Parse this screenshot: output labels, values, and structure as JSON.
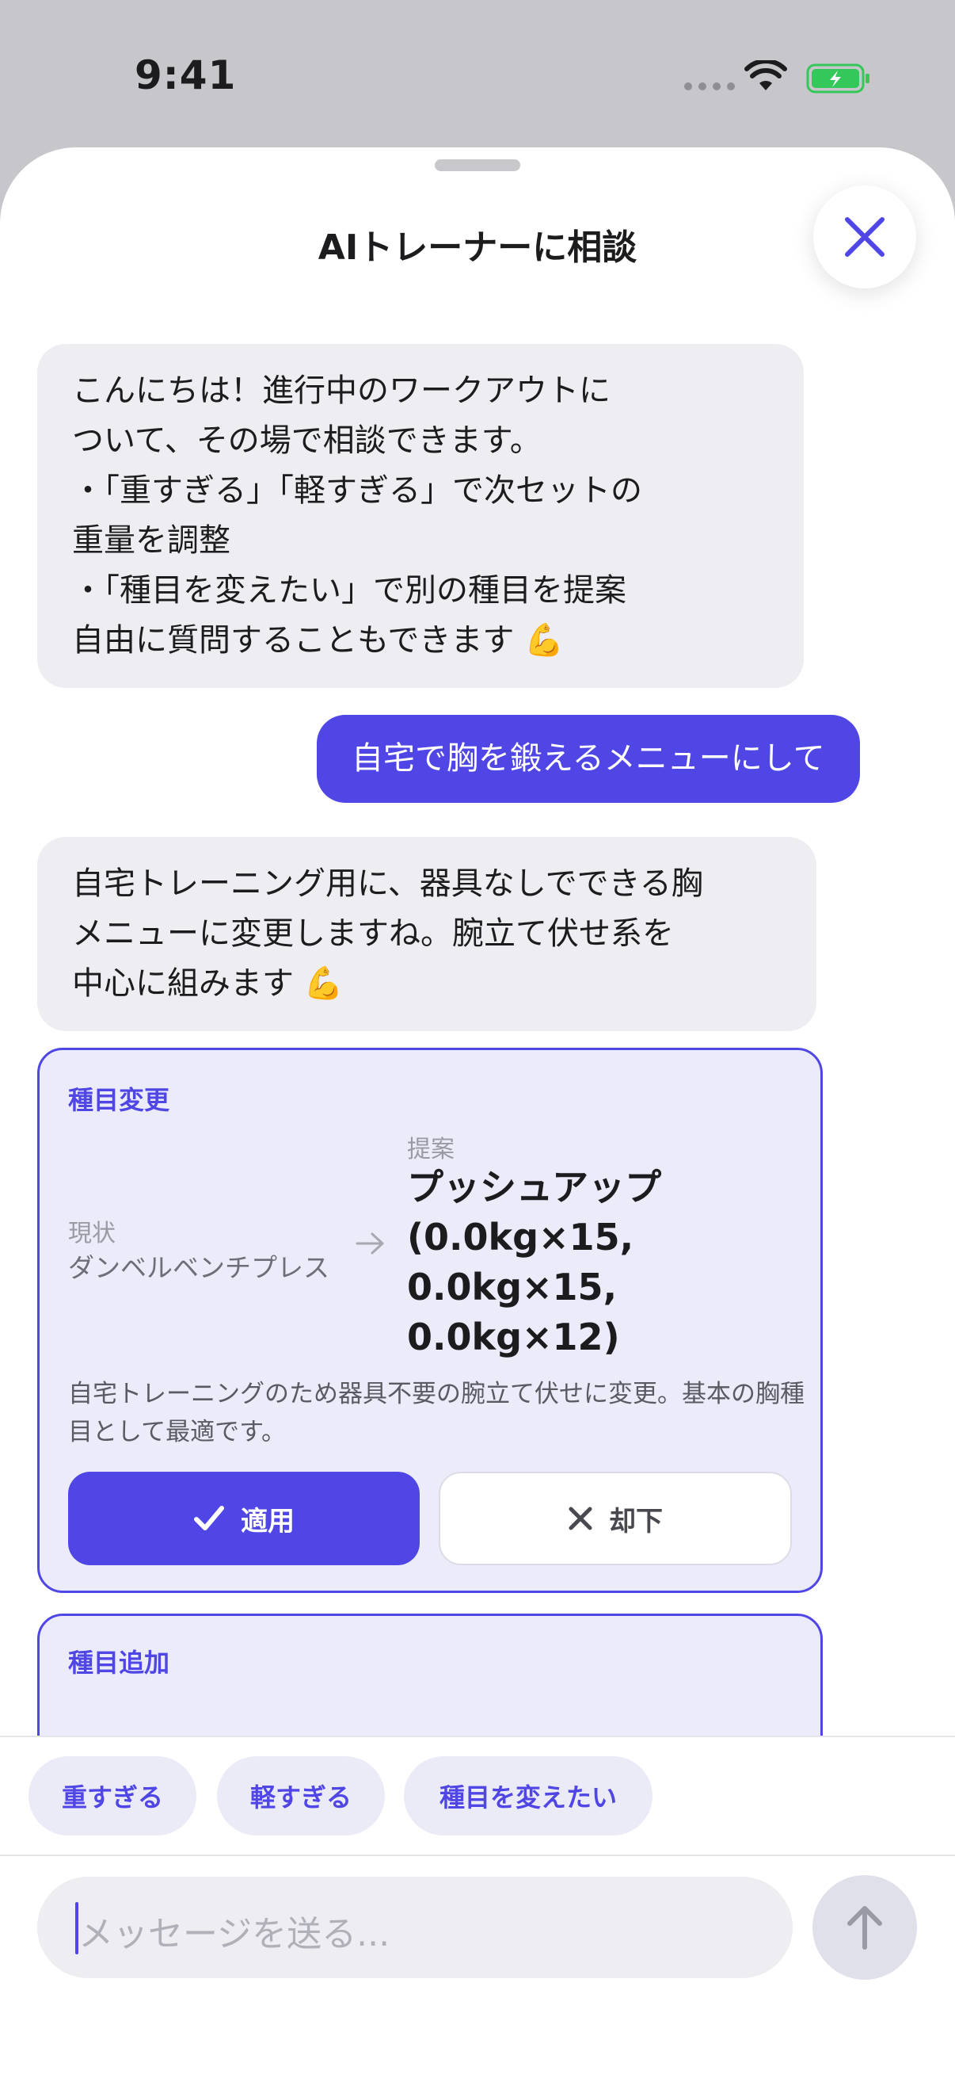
{
  "status": {
    "time": "9:41"
  },
  "sheet": {
    "title": "AIトレーナーに相談"
  },
  "messages": [
    {
      "role": "assistant",
      "text": "こんにちは！進行中のワークアウトに\nついて、その場で相談できます。\n・「重すぎる」「軽すぎる」で次セットの\n重量を調整\n・「種目を変えたい」で別の種目を提案\n自由に質問することもできます 💪"
    },
    {
      "role": "user",
      "text": "自宅で胸を鍛えるメニューにして"
    },
    {
      "role": "assistant",
      "text": "自宅トレーニング用に、器具なしでできる胸\nメニューに変更しますね。腕立て伏せ系を\n中心に組みます 💪"
    }
  ],
  "suggestion_card": {
    "label": "種目変更",
    "current_label": "現状",
    "current_value": "ダンベルベンチプレス",
    "proposal_label": "提案",
    "proposal_value": "プッシュアップ\n(0.0kg×15,\n0.0kg×15,\n0.0kg×12)",
    "note": "自宅トレーニングのため器具不要の腕立て伏せに変更。基本の胸種目として最適です。",
    "apply_label": "適用",
    "reject_label": "却下"
  },
  "second_card": {
    "label": "種目追加"
  },
  "quick_replies": [
    "重すぎる",
    "軽すぎる",
    "種目を変えたい"
  ],
  "composer": {
    "placeholder": "メッセージを送る..."
  },
  "colors": {
    "accent": "#4f46e5",
    "bubble_ai": "#ededf2",
    "card_bg": "#ebebfa"
  }
}
